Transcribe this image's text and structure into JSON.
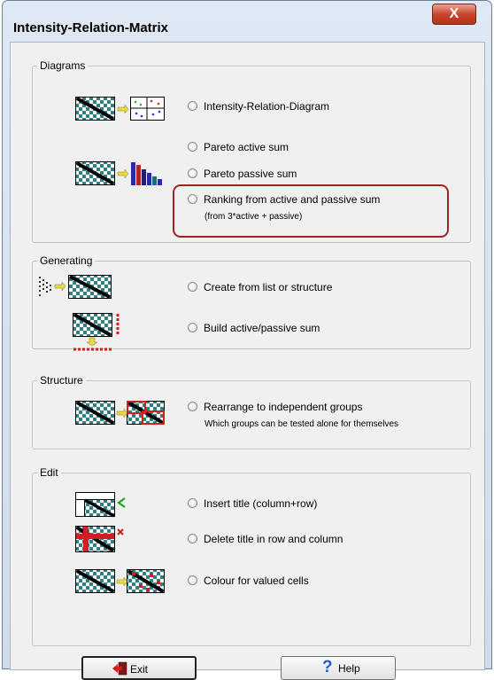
{
  "window": {
    "title": "Intensity-Relation-Matrix",
    "close_glyph": "X"
  },
  "groups": {
    "diagrams": {
      "label": "Diagrams",
      "options": [
        {
          "label": "Intensity-Relation-Diagram"
        },
        {
          "label": "Pareto active sum"
        },
        {
          "label": "Pareto passive sum"
        },
        {
          "label": "Ranking from active and passive sum",
          "sub": "(from 3*active + passive)"
        }
      ]
    },
    "generating": {
      "label": "Generating",
      "options": [
        {
          "label": "Create from list or structure"
        },
        {
          "label": "Build active/passive sum"
        }
      ]
    },
    "structure": {
      "label": "Structure",
      "options": [
        {
          "label": "Rearrange to independent groups",
          "sub": "Which groups can be tested alone for themselves"
        }
      ]
    },
    "edit": {
      "label": "Edit",
      "options": [
        {
          "label": "Insert title (column+row)"
        },
        {
          "label": "Delete title in row and column"
        },
        {
          "label": "Colour for valued cells"
        }
      ]
    }
  },
  "buttons": {
    "exit": "Exit",
    "help": "Help",
    "help_glyph": "?"
  },
  "colors": {
    "accent_highlight": "#a12222",
    "matrix_teal": "#2f7f84",
    "matrix_dark": "#1a1a1a"
  }
}
